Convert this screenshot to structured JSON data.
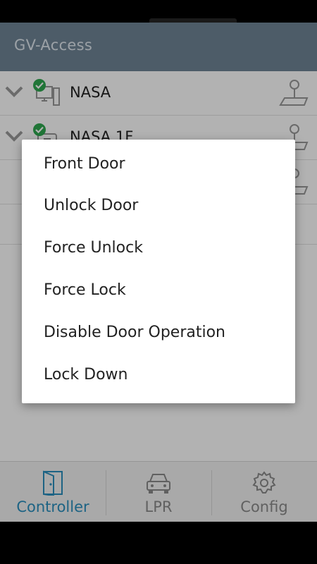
{
  "app": {
    "title": "GV-Access"
  },
  "controllers": [
    {
      "name": "NASA",
      "status": "online"
    },
    {
      "name": "NASA 1F",
      "status": "online"
    },
    {
      "name": "",
      "status": "unknown"
    }
  ],
  "nav": [
    {
      "label": "Controller",
      "icon": "door-icon",
      "active": true
    },
    {
      "label": "LPR",
      "icon": "car-icon",
      "active": false
    },
    {
      "label": "Config",
      "icon": "gear-icon",
      "active": false
    }
  ],
  "dialog": {
    "title": "Front Door",
    "options": [
      "Unlock Door",
      "Force Unlock",
      "Force Lock",
      "Disable Door Operation",
      "Lock Down"
    ]
  },
  "colors": {
    "appbar": "#6f8496",
    "accent": "#2a8fbd",
    "online": "#2fa84f"
  }
}
